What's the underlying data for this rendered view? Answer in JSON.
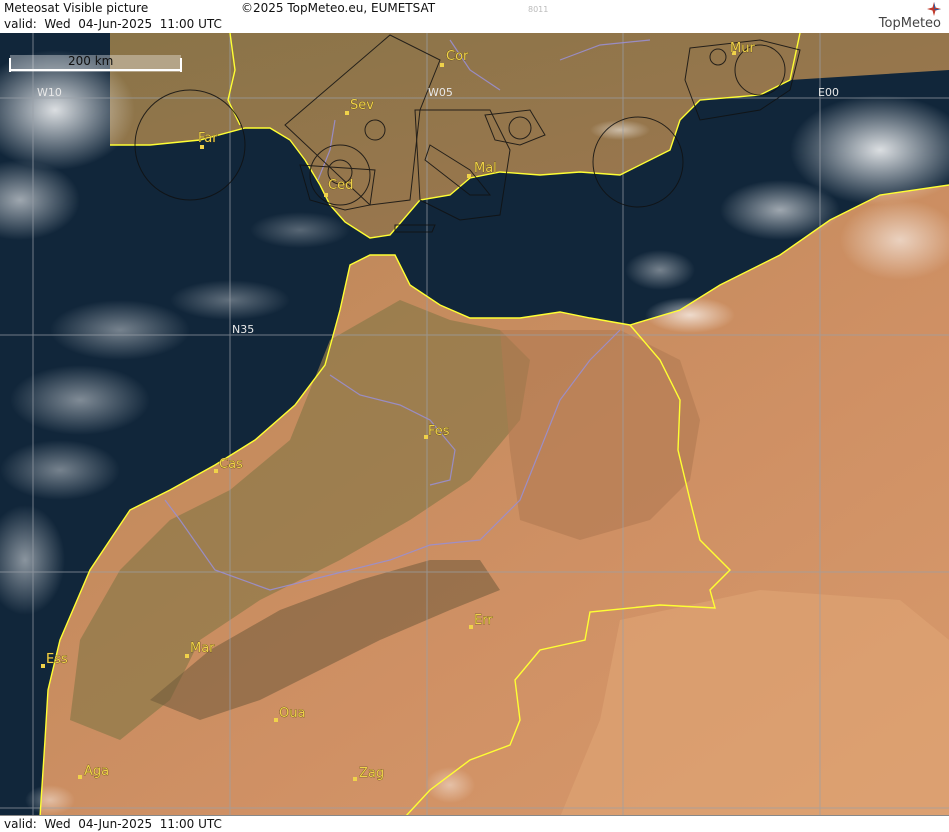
{
  "header": {
    "title": "Meteosat Visible picture",
    "copyright": "©2025 TopMeteo.eu, EUMETSAT",
    "valid": "valid:  Wed  04-Jun-2025  11:00 UTC",
    "code": "8011",
    "logo": "TopMeteo"
  },
  "scale_bar": {
    "label": "200 km"
  },
  "grid_labels": {
    "w10": "W10",
    "w05": "W05",
    "e00": "E00",
    "n35": "N35"
  },
  "cities": {
    "cor": "Cor",
    "mur": "Mur",
    "sev": "Sev",
    "far": "Far",
    "ced": "Ced",
    "mal": "Mal",
    "fes": "Fes",
    "cas": "Cas",
    "ess": "Ess",
    "mar": "Mar",
    "err": "Err",
    "oua": "Oua",
    "aga": "Aga",
    "zag": "Zag"
  },
  "footer": {
    "valid": "valid:  Wed  04-Jun-2025  11:00 UTC"
  },
  "colors": {
    "sea": "#0f2233",
    "land_desert": "#c98a5a",
    "land_green": "#8c7a48",
    "border": "#ffff33",
    "river": "#9a8fd0",
    "grid": "#9aa0a8",
    "label": "#f0d24a"
  }
}
